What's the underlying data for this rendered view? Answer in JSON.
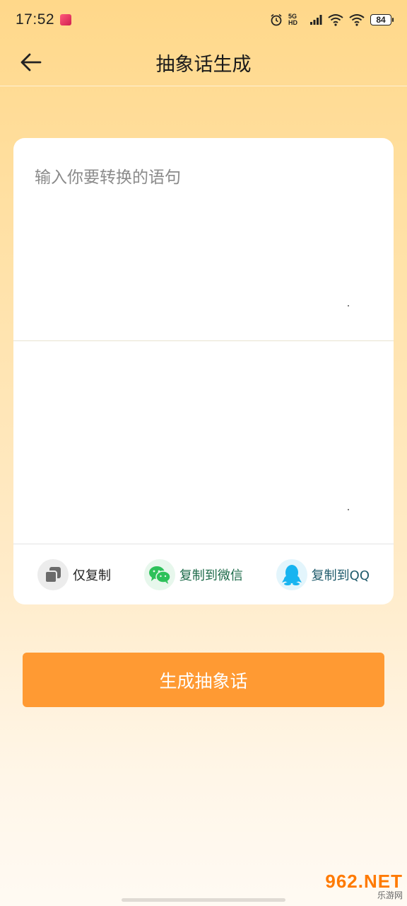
{
  "status_bar": {
    "time": "17:52",
    "battery": "84",
    "network": "5G HD"
  },
  "header": {
    "title": "抽象话生成",
    "back_icon": "arrow-left-icon"
  },
  "input": {
    "placeholder": "输入你要转换的语句",
    "value": ""
  },
  "output": {
    "value": ""
  },
  "actions": [
    {
      "label": "仅复制",
      "icon": "copy-icon",
      "color": "#6b6b6b"
    },
    {
      "label": "复制到微信",
      "icon": "wechat-icon",
      "color": "#2dc15a"
    },
    {
      "label": "复制到QQ",
      "icon": "qq-icon",
      "color": "#18b4f0"
    }
  ],
  "generate_button": {
    "label": "生成抽象话",
    "color": "#FF9A33"
  },
  "watermark": {
    "main": "962.NET",
    "sub": "乐游网"
  },
  "colors": {
    "background_top": "#FFD88A",
    "background_bottom": "#FFFAF3",
    "accent": "#FF9A33"
  }
}
